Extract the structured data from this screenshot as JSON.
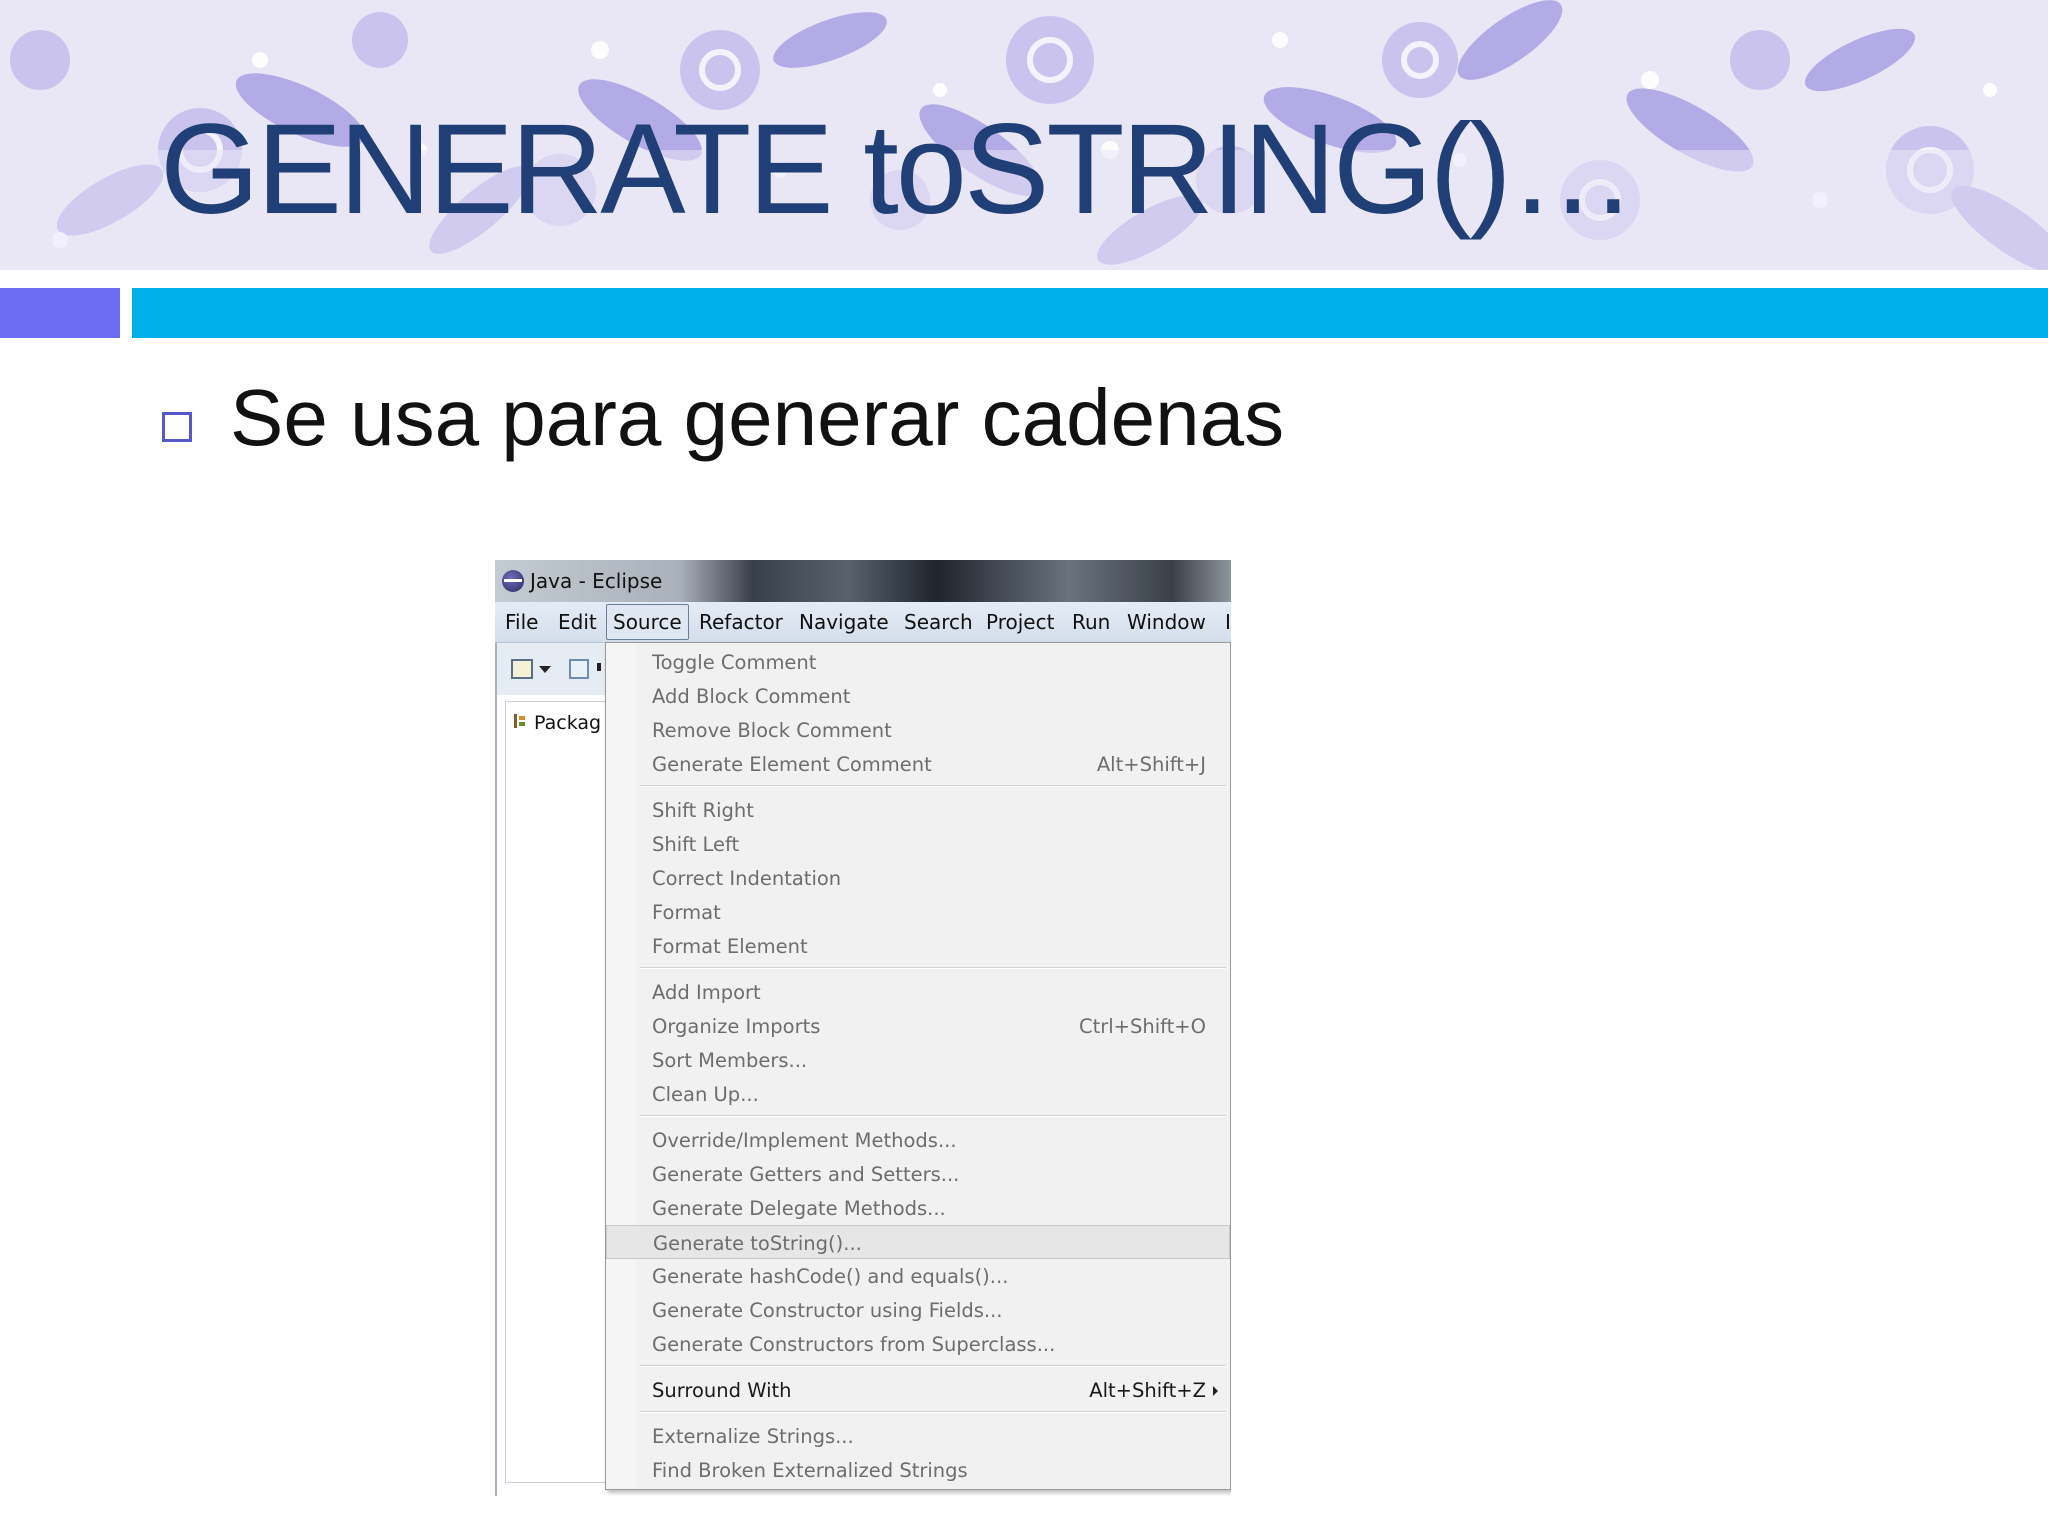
{
  "slide": {
    "title": "GENERATE toSTRING()…",
    "bullet": "Se usa para generar cadenas",
    "colors": {
      "title": "#1f3f76",
      "accent_bar": "#00aeea",
      "accent_block": "#6a6cf2"
    }
  },
  "eclipse": {
    "window_title": "Java - Eclipse",
    "menubar": [
      "File",
      "Edit",
      "Source",
      "Refactor",
      "Navigate",
      "Search",
      "Project",
      "Run",
      "Window",
      "I"
    ],
    "active_menu": "Source",
    "package_view_label": "Packag",
    "source_menu": [
      {
        "label": "Toggle Comment",
        "accel": ""
      },
      {
        "label": "Add Block Comment",
        "accel": ""
      },
      {
        "label": "Remove Block Comment",
        "accel": ""
      },
      {
        "label": "Generate Element Comment",
        "accel": "Alt+Shift+J"
      },
      {
        "label": "Shift Right",
        "accel": ""
      },
      {
        "label": "Shift Left",
        "accel": ""
      },
      {
        "label": "Correct Indentation",
        "accel": ""
      },
      {
        "label": "Format",
        "accel": ""
      },
      {
        "label": "Format Element",
        "accel": ""
      },
      {
        "label": "Add Import",
        "accel": ""
      },
      {
        "label": "Organize Imports",
        "accel": "Ctrl+Shift+O"
      },
      {
        "label": "Sort Members...",
        "accel": ""
      },
      {
        "label": "Clean Up...",
        "accel": ""
      },
      {
        "label": "Override/Implement Methods...",
        "accel": ""
      },
      {
        "label": "Generate Getters and Setters...",
        "accel": ""
      },
      {
        "label": "Generate Delegate Methods...",
        "accel": ""
      },
      {
        "label": "Generate toString()...",
        "accel": ""
      },
      {
        "label": "Generate hashCode() and equals()...",
        "accel": ""
      },
      {
        "label": "Generate Constructor using Fields...",
        "accel": ""
      },
      {
        "label": "Generate Constructors from Superclass...",
        "accel": ""
      },
      {
        "label": "Surround With",
        "accel": "Alt+Shift+Z"
      },
      {
        "label": "Externalize Strings...",
        "accel": ""
      },
      {
        "label": "Find Broken Externalized Strings",
        "accel": ""
      }
    ]
  }
}
